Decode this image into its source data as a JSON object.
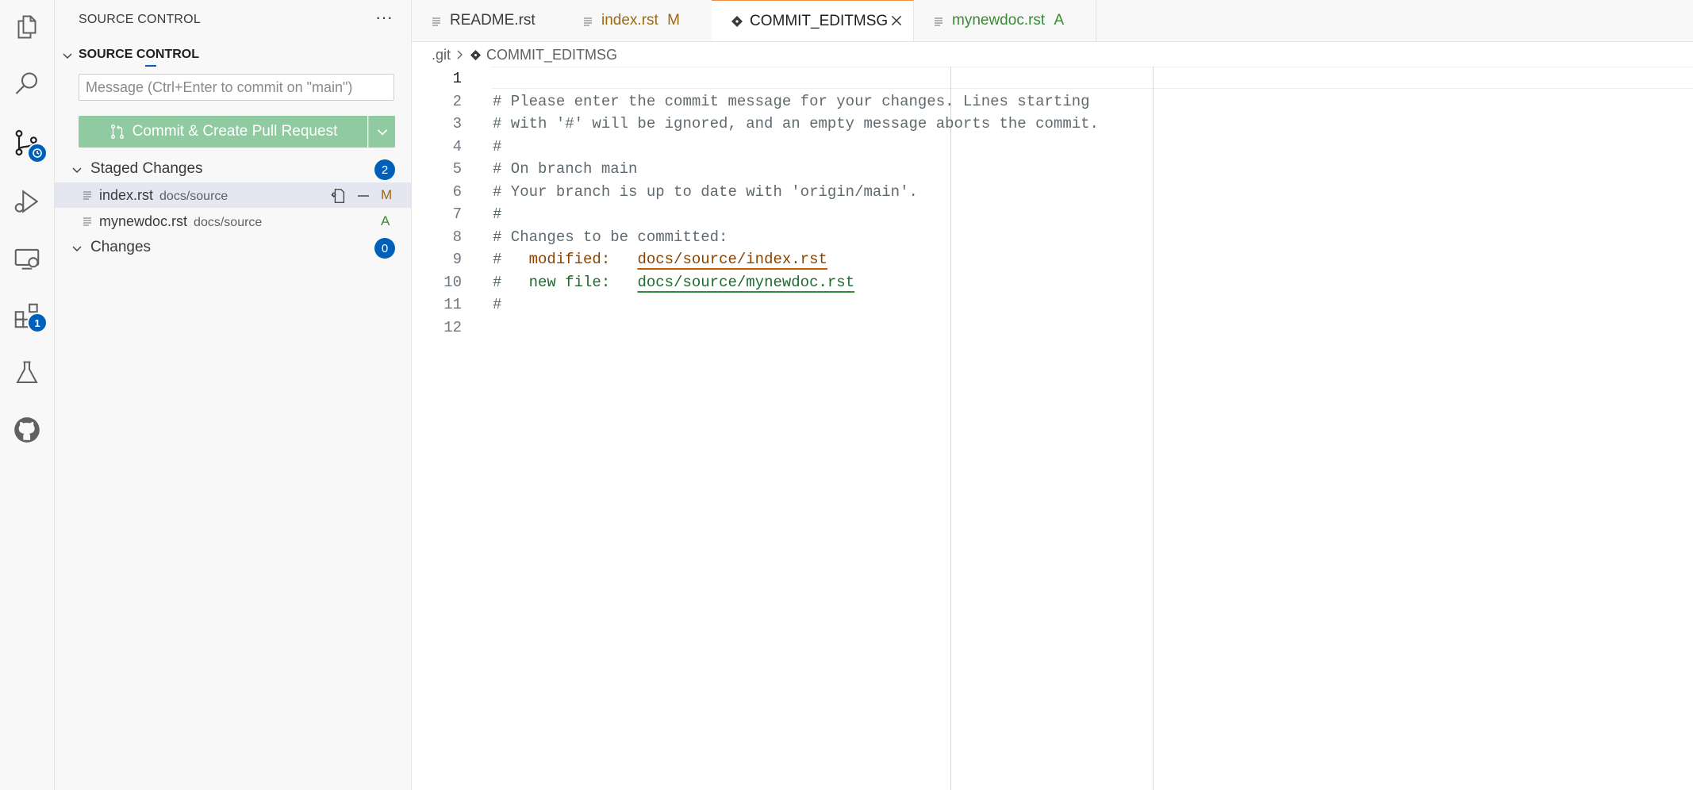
{
  "activity_bar": {
    "items": [
      {
        "name": "explorer-icon"
      },
      {
        "name": "search-icon"
      },
      {
        "name": "source-control-icon"
      },
      {
        "name": "run-debug-icon"
      },
      {
        "name": "remote-explorer-icon"
      },
      {
        "name": "extensions-icon",
        "badge": "1"
      },
      {
        "name": "testing-icon"
      },
      {
        "name": "github-icon"
      }
    ],
    "accent_color": "#005fb8"
  },
  "sidebar": {
    "title": "SOURCE CONTROL",
    "more_label": "···",
    "section_title": "SOURCE CONTROL",
    "commit_input": {
      "value": "",
      "placeholder": "Message (Ctrl+Enter to commit on \"main\")"
    },
    "commit_button_label": "Commit & Create Pull Request",
    "staged": {
      "label": "Staged Changes",
      "count": "2",
      "files": [
        {
          "name": "index.rst",
          "path": "docs/source",
          "status": "M",
          "status_color": "#9b6a11",
          "selected": true
        },
        {
          "name": "mynewdoc.rst",
          "path": "docs/source",
          "status": "A",
          "status_color": "#388a34",
          "selected": false
        }
      ]
    },
    "changes": {
      "label": "Changes",
      "count": "0"
    }
  },
  "tabs": [
    {
      "label": "README.rst",
      "status": "",
      "color": "#3b3b3b"
    },
    {
      "label": "index.rst",
      "status": "M",
      "color": "#9b6a11"
    },
    {
      "label": "COMMIT_EDITMSG",
      "status": "",
      "color": "#1f1f1f",
      "active": true
    },
    {
      "label": "mynewdoc.rst",
      "status": "A",
      "color": "#388a34"
    }
  ],
  "breadcrumb": {
    "folder": ".git",
    "file": "COMMIT_EDITMSG"
  },
  "editor": {
    "lines": [
      {
        "n": "1",
        "text": ""
      },
      {
        "n": "2",
        "text": "# Please enter the commit message for your changes. Lines starting"
      },
      {
        "n": "3",
        "text": "# with '#' will be ignored, and an empty message aborts the commit."
      },
      {
        "n": "4",
        "text": "#"
      },
      {
        "n": "5",
        "text": "# On branch main"
      },
      {
        "n": "6",
        "text": "# Your branch is up to date with 'origin/main'."
      },
      {
        "n": "7",
        "text": "#"
      },
      {
        "n": "8",
        "text": "# Changes to be committed:"
      },
      {
        "n": "9",
        "prefix": "#   ",
        "keyword": "modified:",
        "gap": "   ",
        "path": "docs/source/index.rst"
      },
      {
        "n": "10",
        "prefix": "#   ",
        "keyword": "new file:",
        "gap": "   ",
        "path": "docs/source/mynewdoc.rst"
      },
      {
        "n": "11",
        "text": "#"
      },
      {
        "n": "12",
        "text": ""
      }
    ]
  }
}
